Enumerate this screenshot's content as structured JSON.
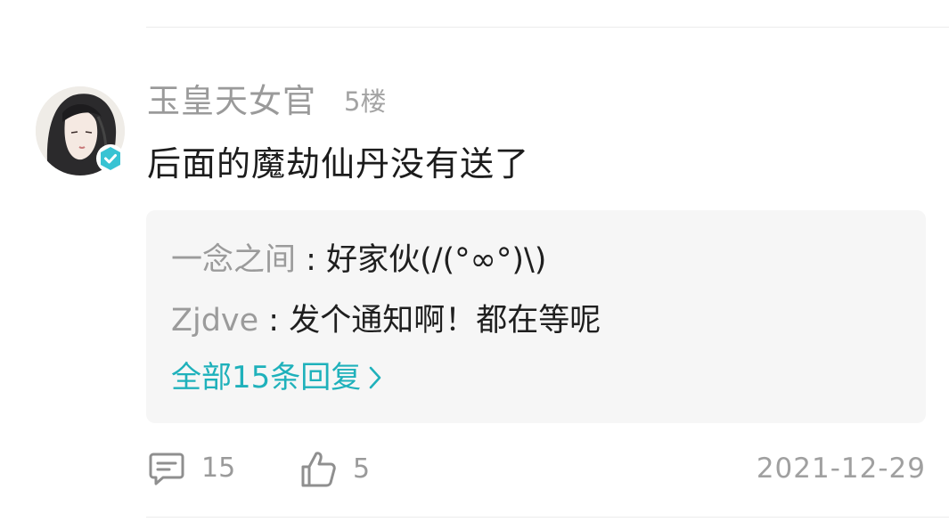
{
  "comment": {
    "username": "玉皇天女官",
    "floor": "5楼",
    "text": "后面的魔劫仙丹没有送了",
    "date": "2021-12-29",
    "reply_count": "15",
    "like_count": "5"
  },
  "replies": [
    {
      "name": "一念之间",
      "separator": " : ",
      "text": "好家伙(/(°∞°)\\)"
    },
    {
      "name": "Zjdve",
      "separator": " : ",
      "text": "发个通知啊！都在等呢"
    }
  ],
  "all_replies_label": "全部15条回复",
  "colors": {
    "accent": "#1fb1bb",
    "badge": "#38c3d3",
    "muted": "#9a9a9a",
    "reply_bg": "#f6f6f6"
  },
  "icons": [
    "verified-badge-icon",
    "chevron-right-icon",
    "comment-icon",
    "thumbs-up-icon"
  ]
}
